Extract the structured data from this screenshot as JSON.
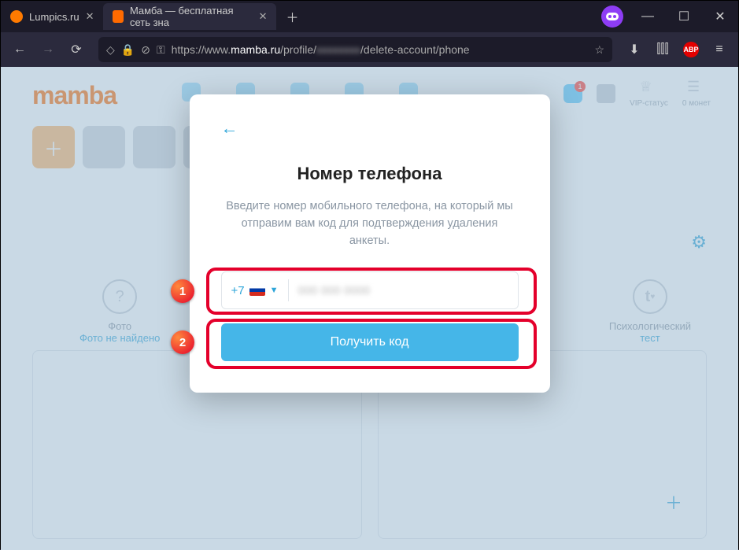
{
  "browser": {
    "tabs": [
      {
        "label": "Lumpics.ru"
      },
      {
        "label": "Мамба — бесплатная сеть зна"
      }
    ],
    "url_prefix": "https://www.",
    "url_domain": "mamba.ru",
    "url_path_1": "/profile/",
    "url_path_2": "/delete-account/phone"
  },
  "page": {
    "logo": "mamba",
    "notif_count": "1",
    "right_tiles": {
      "vip": "VIP-статус",
      "coins": "0 монет"
    },
    "col_left": {
      "title": "Фото",
      "link": "Фото не найдено"
    },
    "col_right": {
      "title": "Психологический",
      "link": "тест"
    }
  },
  "modal": {
    "title": "Номер телефона",
    "description": "Введите номер мобильного телефона, на который мы отправим вам код для подтверждения удаления анкеты.",
    "country_code": "+7",
    "button": "Получить код"
  },
  "annotations": {
    "step1": "1",
    "step2": "2"
  }
}
